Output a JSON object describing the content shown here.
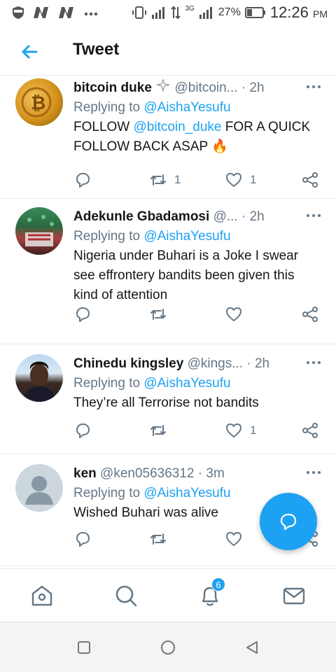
{
  "status_bar": {
    "battery_percent": "27%",
    "network_type": "3G",
    "time": "12:26",
    "ampm": "PM"
  },
  "header": {
    "title": "Tweet"
  },
  "tweets": [
    {
      "name": "bitcoin duke",
      "handle": "@bitcoin...",
      "time": "2h",
      "replying_prefix": "Replying to",
      "replying_to": "@AishaYesufu",
      "text_before": "FOLLOW",
      "text_mention": "@bitcoin_duke",
      "text_after": "FOR A QUICK FOLLOW BACK ASAP 🔥",
      "retweets": "1",
      "likes": "1"
    },
    {
      "name": "Adekunle Gbadamosi",
      "handle": "@...",
      "time": "2h",
      "replying_prefix": "Replying to",
      "replying_to": "@AishaYesufu",
      "text": "Nigeria under Buhari is a Joke I swear see effrontery bandits been given this kind of attention"
    },
    {
      "name": "Chinedu kingsley",
      "handle": "@kings...",
      "time": "2h",
      "replying_prefix": "Replying to",
      "replying_to": "@AishaYesufu",
      "text": "They’re all Terrorise not bandits",
      "likes": "1"
    },
    {
      "name": "ken",
      "handle": "@ken05636312",
      "time": "3m",
      "replying_prefix": "Replying to",
      "replying_to": "@AishaYesufu",
      "text": "Wished Buhari was alive"
    }
  ],
  "bottom_nav": {
    "notifications_badge": "6"
  },
  "colors": {
    "accent": "#1da1f2",
    "secondary_text": "#657786",
    "divider": "#e6ecf0"
  },
  "icons": {
    "back": "arrow-left-icon",
    "more": "more-dots-icon",
    "reply": "reply-bubble-icon",
    "retweet": "retweet-icon",
    "like": "heart-icon",
    "share": "share-icon",
    "compose_reply": "chat-bubble-icon",
    "home": "home-icon",
    "search": "search-icon",
    "notifications": "bell-icon",
    "messages": "mail-icon"
  }
}
